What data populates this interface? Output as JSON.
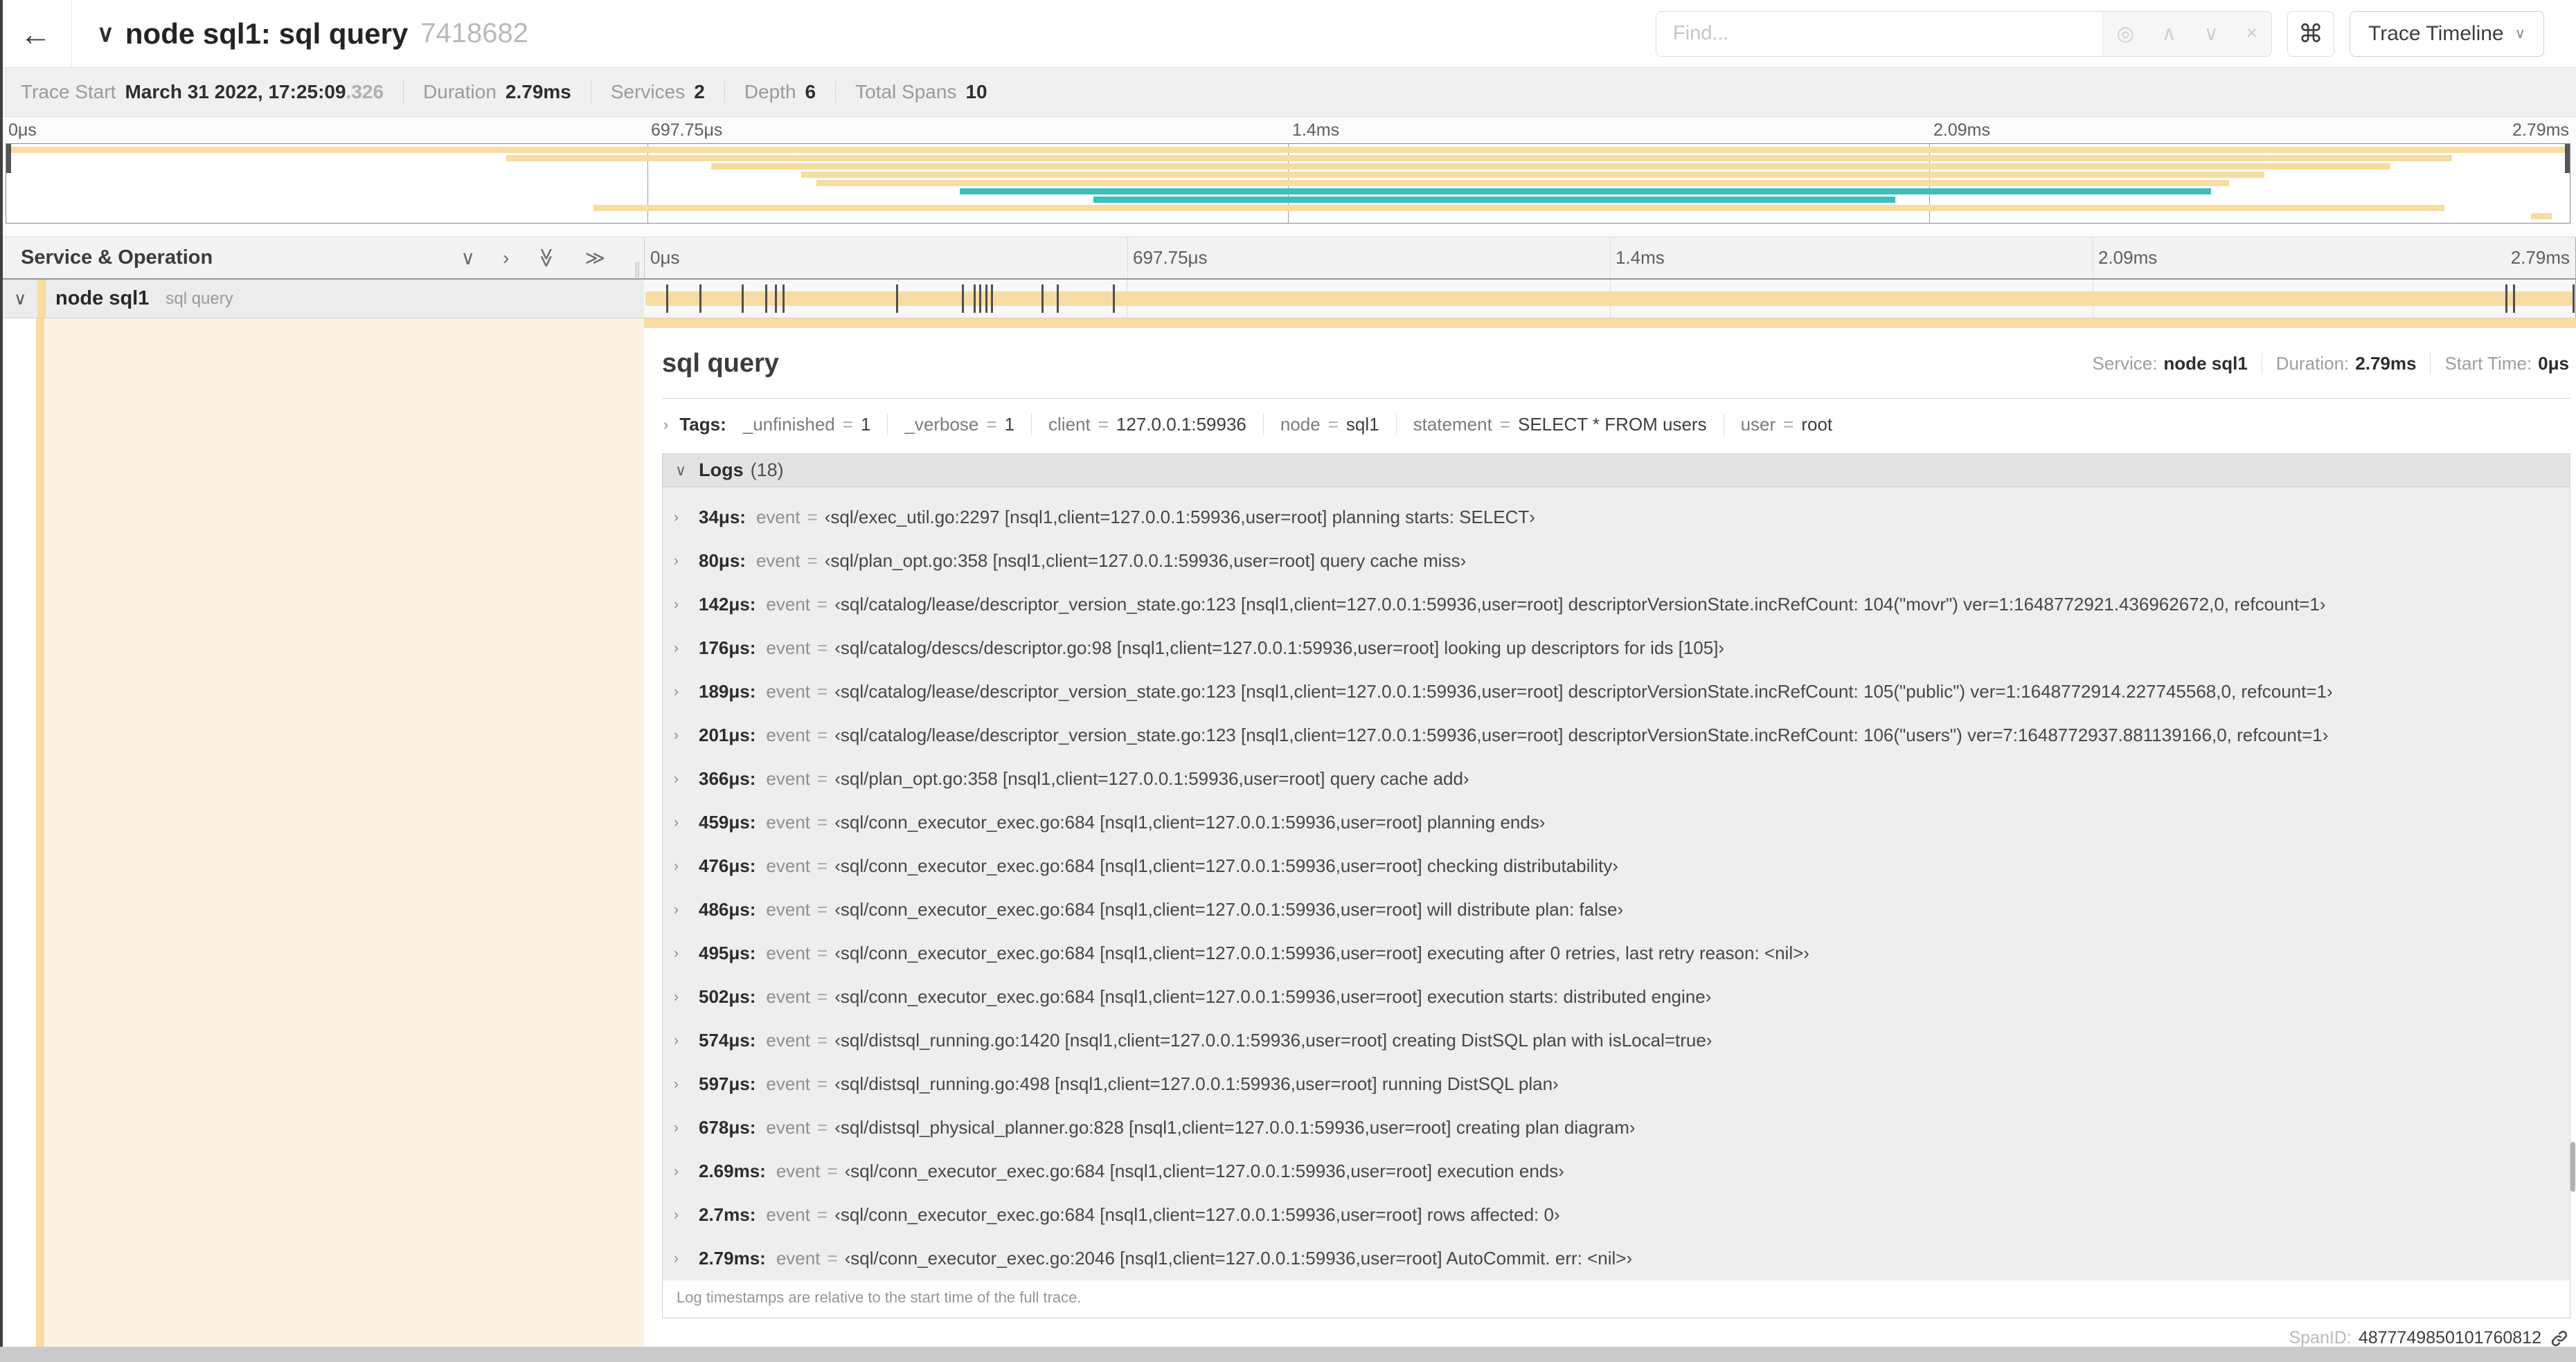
{
  "colors": {
    "tan": "#f8dca1",
    "teal": "#3dc0bb",
    "cream": "#faf3e3"
  },
  "header": {
    "back_icon": "←",
    "collapse_icon": "∨",
    "title": "node sql1: sql query",
    "trace_id": "7418682",
    "find_placeholder": "Find...",
    "icons": {
      "locate": "◎",
      "prev": "∧",
      "next": "∨",
      "clear": "×",
      "command": "⌘",
      "caret": "∨"
    },
    "view_select": "Trace Timeline"
  },
  "summary": {
    "trace_start_label": "Trace Start",
    "trace_start_value": "March 31 2022, 17:25:09",
    "trace_start_frac": ".326",
    "duration_label": "Duration",
    "duration_value": "2.79ms",
    "services_label": "Services",
    "services_value": "2",
    "depth_label": "Depth",
    "depth_value": "6",
    "total_spans_label": "Total Spans",
    "total_spans_value": "10"
  },
  "minimap": {
    "axis_ticks": [
      "0μs",
      "697.75μs",
      "1.4ms",
      "2.09ms",
      "2.79ms"
    ],
    "spans": [
      {
        "start": 0,
        "end": 100,
        "color": "tan"
      },
      {
        "start": 19.5,
        "end": 95.4,
        "color": "tan"
      },
      {
        "start": 27.5,
        "end": 93.0,
        "color": "tan"
      },
      {
        "start": 31.0,
        "end": 88.1,
        "color": "tan"
      },
      {
        "start": 31.6,
        "end": 86.7,
        "color": "tan"
      },
      {
        "start": 37.2,
        "end": 86.0,
        "color": "teal"
      },
      {
        "start": 42.4,
        "end": 73.7,
        "color": "teal"
      },
      {
        "start": 22.9,
        "end": 95.1,
        "color": "tan"
      },
      {
        "start": 98.5,
        "end": 99.3,
        "color": "tan"
      }
    ]
  },
  "timeline": {
    "left_header": "Service & Operation",
    "collapse_icons": [
      "∨",
      "›",
      "≫",
      "≫"
    ],
    "grip_icon": "∥",
    "axis_ticks": [
      "0μs",
      "697.75μs",
      "1.4ms",
      "2.09ms",
      "2.79ms"
    ],
    "span_row": {
      "collapse_icon": "∨",
      "service": "node sql1",
      "operation": "sql query",
      "bar_start_pct": 0,
      "bar_end_pct": 100,
      "log_tick_pcts": [
        1.2,
        2.9,
        5.1,
        6.3,
        6.8,
        7.2,
        13.1,
        16.5,
        17.1,
        17.4,
        17.7,
        18.0,
        20.6,
        21.4,
        24.3,
        96.4,
        96.8,
        100
      ]
    }
  },
  "detail": {
    "title": "sql query",
    "service_label": "Service:",
    "service_value": "node sql1",
    "duration_label": "Duration:",
    "duration_value": "2.79ms",
    "start_time_label": "Start Time:",
    "start_time_value": "0μs",
    "tags_chevron": "›",
    "tags_label": "Tags:",
    "eq": "=",
    "tags": [
      {
        "key": "_unfinished",
        "value": "1"
      },
      {
        "key": "_verbose",
        "value": "1"
      },
      {
        "key": "client",
        "value": "127.0.0.1:59936"
      },
      {
        "key": "node",
        "value": "sql1"
      },
      {
        "key": "statement",
        "value": "SELECT * FROM users"
      },
      {
        "key": "user",
        "value": "root"
      }
    ],
    "logs_chevron": "∨",
    "logs_label": "Logs",
    "logs_count": "(18)",
    "log_row_chevron": "›",
    "logs": [
      {
        "time": "34μs:",
        "field": "event",
        "value": "‹sql/exec_util.go:2297 [nsql1,client=127.0.0.1:59936,user=root] planning starts: SELECT›"
      },
      {
        "time": "80μs:",
        "field": "event",
        "value": "‹sql/plan_opt.go:358 [nsql1,client=127.0.0.1:59936,user=root] query cache miss›"
      },
      {
        "time": "142μs:",
        "field": "event",
        "value": "‹sql/catalog/lease/descriptor_version_state.go:123 [nsql1,client=127.0.0.1:59936,user=root] descriptorVersionState.incRefCount: 104(\"movr\") ver=1:1648772921.436962672,0, refcount=1›"
      },
      {
        "time": "176μs:",
        "field": "event",
        "value": "‹sql/catalog/descs/descriptor.go:98 [nsql1,client=127.0.0.1:59936,user=root] looking up descriptors for ids [105]›"
      },
      {
        "time": "189μs:",
        "field": "event",
        "value": "‹sql/catalog/lease/descriptor_version_state.go:123 [nsql1,client=127.0.0.1:59936,user=root] descriptorVersionState.incRefCount: 105(\"public\") ver=1:1648772914.227745568,0, refcount=1›"
      },
      {
        "time": "201μs:",
        "field": "event",
        "value": "‹sql/catalog/lease/descriptor_version_state.go:123 [nsql1,client=127.0.0.1:59936,user=root] descriptorVersionState.incRefCount: 106(\"users\") ver=7:1648772937.881139166,0, refcount=1›"
      },
      {
        "time": "366μs:",
        "field": "event",
        "value": "‹sql/plan_opt.go:358 [nsql1,client=127.0.0.1:59936,user=root] query cache add›"
      },
      {
        "time": "459μs:",
        "field": "event",
        "value": "‹sql/conn_executor_exec.go:684 [nsql1,client=127.0.0.1:59936,user=root] planning ends›"
      },
      {
        "time": "476μs:",
        "field": "event",
        "value": "‹sql/conn_executor_exec.go:684 [nsql1,client=127.0.0.1:59936,user=root] checking distributability›"
      },
      {
        "time": "486μs:",
        "field": "event",
        "value": "‹sql/conn_executor_exec.go:684 [nsql1,client=127.0.0.1:59936,user=root] will distribute plan: false›"
      },
      {
        "time": "495μs:",
        "field": "event",
        "value": "‹sql/conn_executor_exec.go:684 [nsql1,client=127.0.0.1:59936,user=root] executing after 0 retries, last retry reason: <nil>›"
      },
      {
        "time": "502μs:",
        "field": "event",
        "value": "‹sql/conn_executor_exec.go:684 [nsql1,client=127.0.0.1:59936,user=root] execution starts: distributed engine›"
      },
      {
        "time": "574μs:",
        "field": "event",
        "value": "‹sql/distsql_running.go:1420 [nsql1,client=127.0.0.1:59936,user=root] creating DistSQL plan with isLocal=true›"
      },
      {
        "time": "597μs:",
        "field": "event",
        "value": "‹sql/distsql_running.go:498 [nsql1,client=127.0.0.1:59936,user=root] running DistSQL plan›"
      },
      {
        "time": "678μs:",
        "field": "event",
        "value": "‹sql/distsql_physical_planner.go:828 [nsql1,client=127.0.0.1:59936,user=root] creating plan diagram›"
      },
      {
        "time": "2.69ms:",
        "field": "event",
        "value": "‹sql/conn_executor_exec.go:684 [nsql1,client=127.0.0.1:59936,user=root] execution ends›"
      },
      {
        "time": "2.7ms:",
        "field": "event",
        "value": "‹sql/conn_executor_exec.go:684 [nsql1,client=127.0.0.1:59936,user=root] rows affected: 0›"
      },
      {
        "time": "2.79ms:",
        "field": "event",
        "value": "‹sql/conn_executor_exec.go:2046 [nsql1,client=127.0.0.1:59936,user=root] AutoCommit. err: <nil>›"
      }
    ],
    "logs_footer": "Log timestamps are relative to the start time of the full trace.",
    "span_id_label": "SpanID:",
    "span_id_value": "4877749850101760812"
  }
}
